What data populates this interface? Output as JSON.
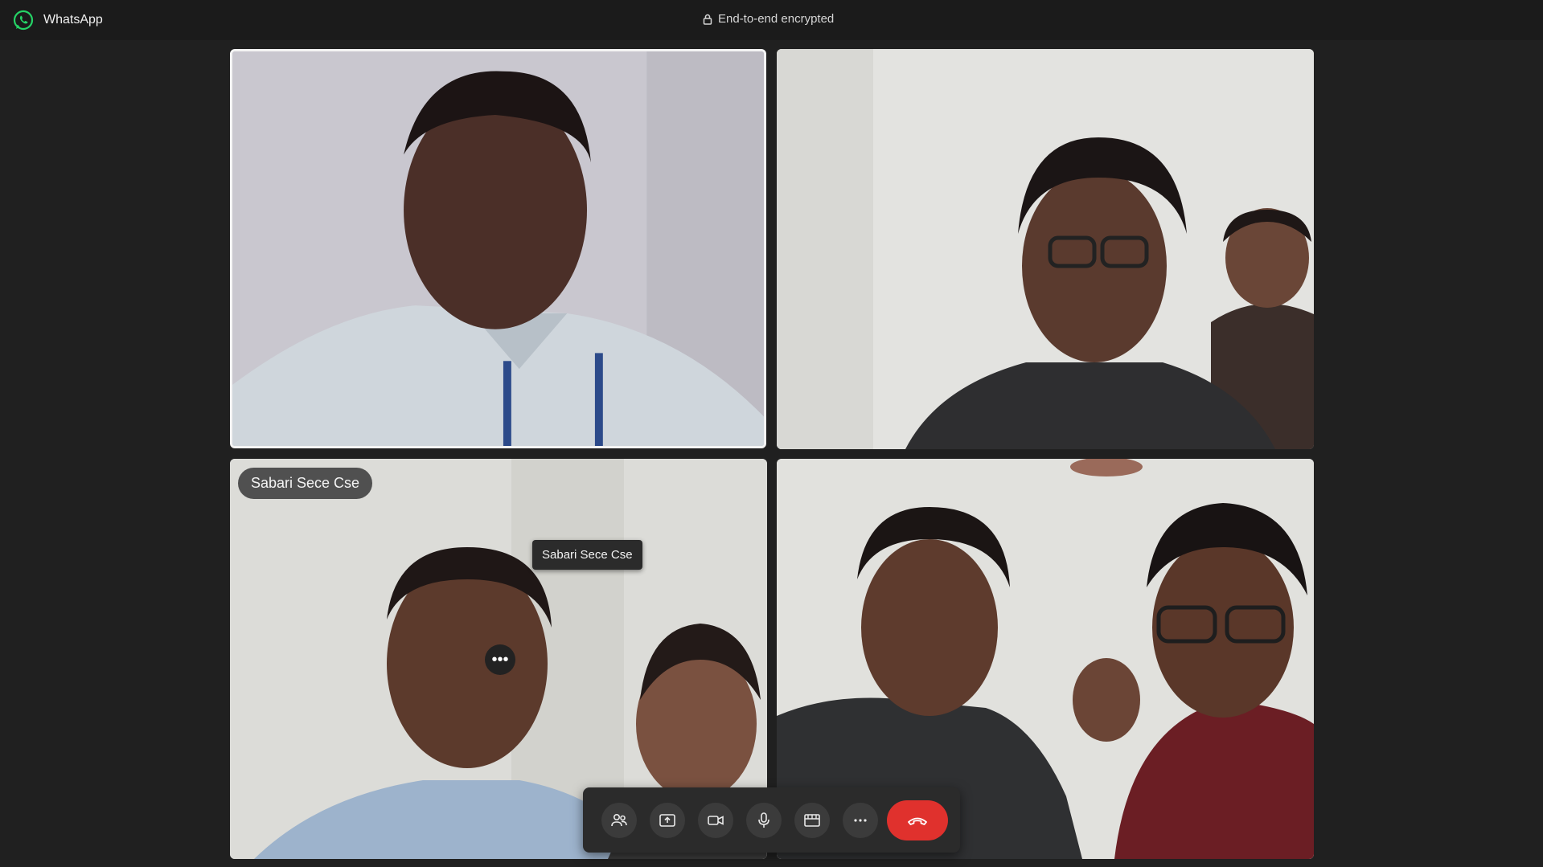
{
  "app": {
    "name": "WhatsApp",
    "encryption_label": "End-to-end encrypted",
    "brand_color": "#25d366"
  },
  "call": {
    "participants": [
      {
        "name": "",
        "active_speaker": true
      },
      {
        "name": ""
      },
      {
        "name": "Sabari Sece Cse"
      },
      {
        "name": ""
      }
    ],
    "tooltip": "Sabari Sece Cse",
    "more_options_glyph": "•••"
  },
  "controls": {
    "buttons": [
      {
        "id": "participants",
        "icon": "people-icon"
      },
      {
        "id": "share",
        "icon": "share-screen-icon"
      },
      {
        "id": "camera",
        "icon": "video-camera-icon"
      },
      {
        "id": "mic",
        "icon": "microphone-icon"
      },
      {
        "id": "layout",
        "icon": "layout-icon"
      },
      {
        "id": "more",
        "icon": "more-horizontal-icon"
      },
      {
        "id": "end",
        "icon": "end-call-icon",
        "color": "#e0312d"
      }
    ]
  }
}
